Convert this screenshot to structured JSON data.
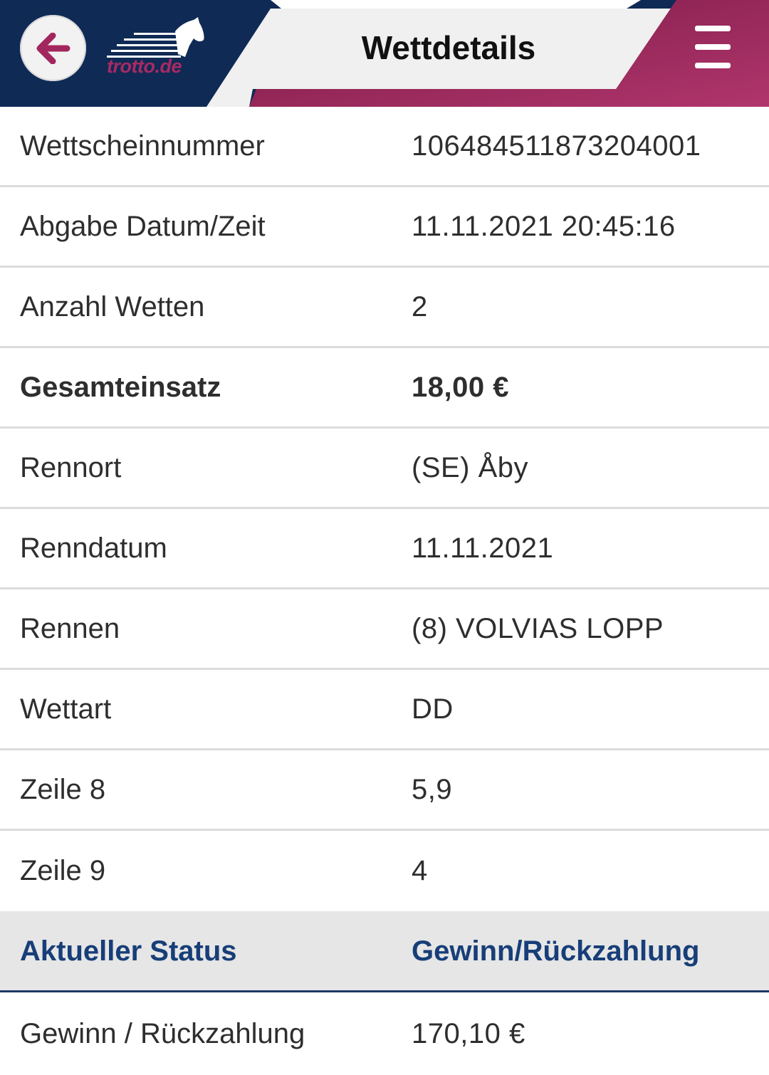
{
  "header": {
    "title": "Wettdetails",
    "logo_text": "trotto.de",
    "colors": {
      "navy": "#0f2a55",
      "magenta": "#a3275f",
      "light": "#f0f0f0"
    }
  },
  "details": [
    {
      "label": "Wettscheinnummer",
      "value": "106484511873204001"
    },
    {
      "label": "Abgabe Datum/Zeit",
      "value": "11.11.2021 20:45:16"
    },
    {
      "label": "Anzahl Wetten",
      "value": "2"
    },
    {
      "label": "Gesamteinsatz",
      "value": "18,00 €"
    },
    {
      "label": "Rennort",
      "value": "(SE) Åby"
    },
    {
      "label": "Renndatum",
      "value": "11.11.2021"
    },
    {
      "label": "Rennen",
      "value": "(8) VOLVIAS LOPP"
    },
    {
      "label": "Wettart",
      "value": "DD"
    },
    {
      "label": "Zeile 8",
      "value": "5,9"
    },
    {
      "label": "Zeile 9",
      "value": "4"
    }
  ],
  "status": {
    "header_label": "Aktueller Status",
    "header_value": "Gewinn/Rückzahlung",
    "row_label": "Gewinn / Rückzahlung",
    "row_value": "170,10 €"
  },
  "icons": {
    "back": "back-arrow-icon",
    "menu": "hamburger-menu-icon",
    "logo": "horse-logo-icon"
  }
}
